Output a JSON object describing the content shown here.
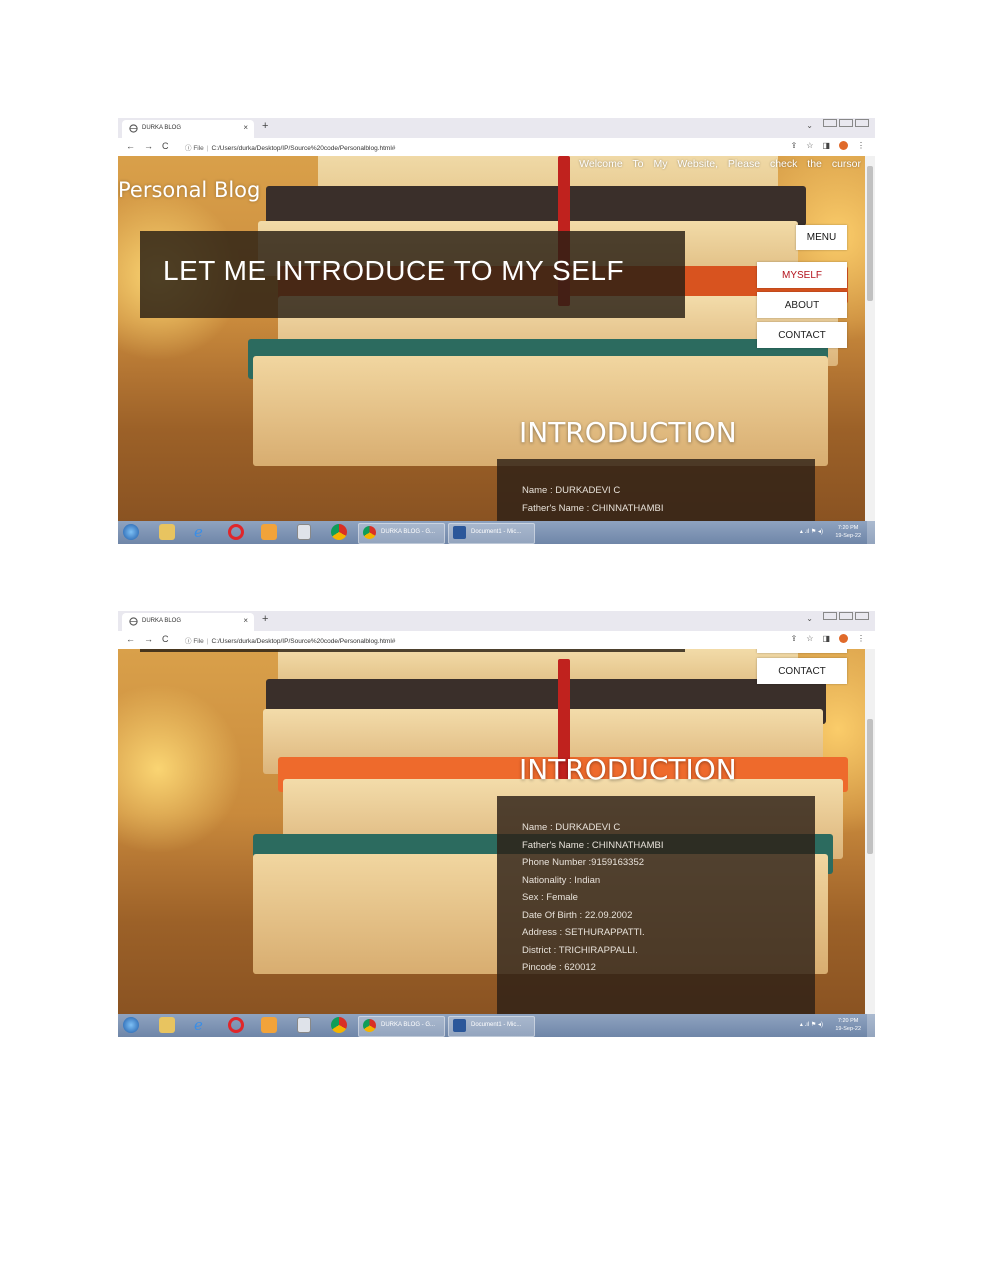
{
  "browser": {
    "tab_title": "DURKA BLOG",
    "tab_close": "×",
    "new_tab": "+",
    "back": "←",
    "forward": "→",
    "reload": "C",
    "info": "ⓘ",
    "file_label": "File",
    "url": "C:/Users/durka/Desktop/IP/Source%20code/Personalblog.html#",
    "share": "⇪",
    "star": "☆",
    "sidepanel": "◨",
    "more": "⋮",
    "chevron": "⌄"
  },
  "site": {
    "welcome": "Welcome To My Website, Please check the cursor",
    "title": "Personal Blog",
    "hero_text": "LET ME INTRODUCE TO MY SELF",
    "menu_label": "MENU",
    "nav": [
      "MYSELF",
      "ABOUT",
      "CONTACT"
    ],
    "intro_title": "INTRODUCTION",
    "intro_rows": [
      "Name : DURKADEVI C",
      "Father's Name : CHINNATHAMBI",
      "Phone Number :9159163352",
      "Nationality : Indian",
      "Sex : Female",
      "Date Of Birth : 22.09.2002",
      "Address : SETHURAPPATTI.",
      "District : TRICHIRAPPALLI.",
      "Pincode : 620012"
    ]
  },
  "taskbar": {
    "chrome_button": "DURKA BLOG - G...",
    "word_button": "Document1 - Mic...",
    "tray": "▴ .ıl ⚑ ◂)",
    "time": "7:20 PM",
    "date": "19-Sep-22"
  },
  "colors": {
    "active_nav": "#b3121c",
    "taskbar": "#7f95b6",
    "overlay": "#2d2016"
  },
  "icons": [
    "chrome-icon",
    "folder-icon",
    "ie-icon",
    "opera-icon",
    "media-player-icon",
    "calculator-icon",
    "word-icon",
    "windows-start-icon"
  ]
}
